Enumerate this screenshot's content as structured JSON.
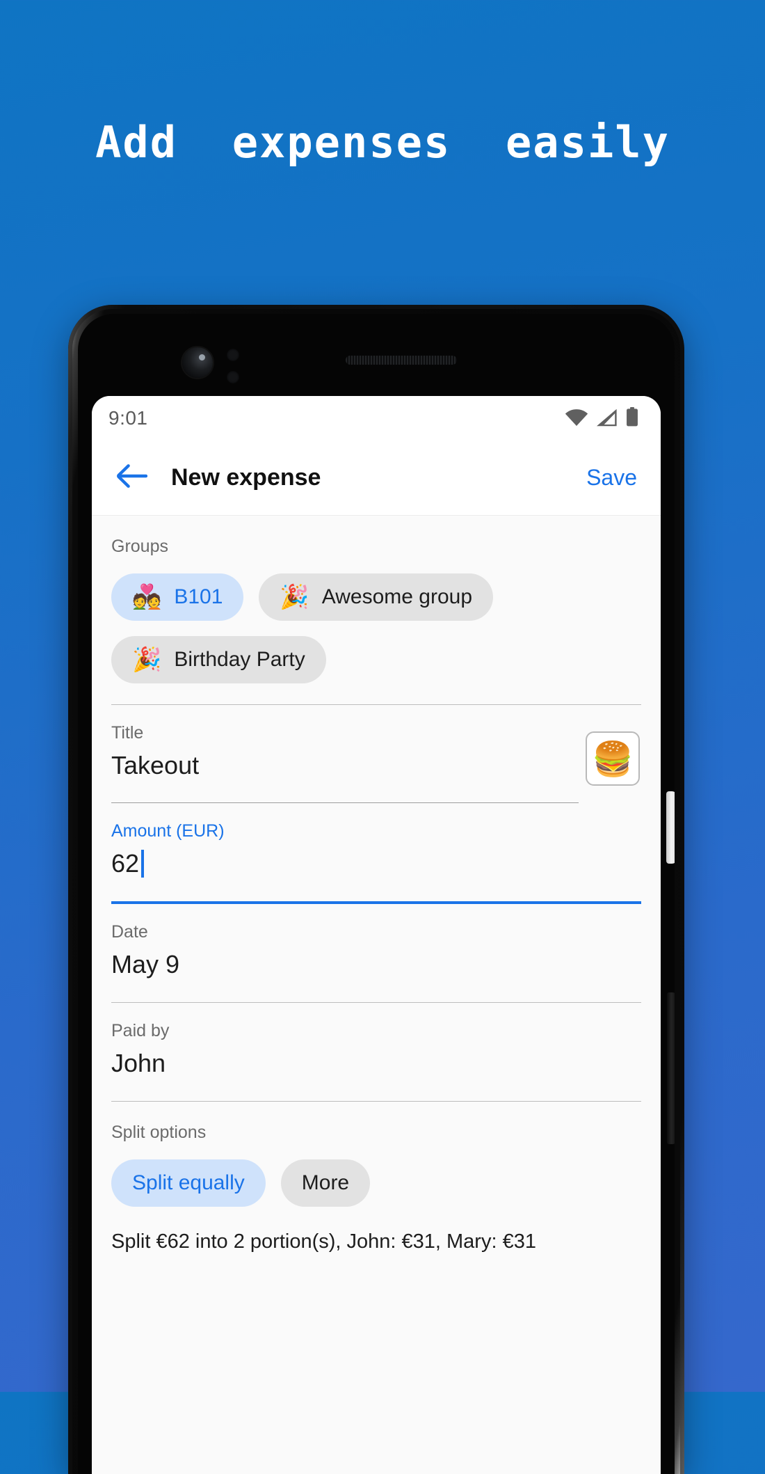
{
  "promo": {
    "headline": "Add  expenses  easily",
    "background_top": "#0f74c3",
    "background_bottom": "#3568cc"
  },
  "status_bar": {
    "time": "9:01",
    "icons": [
      "wifi-icon",
      "cell-signal-icon",
      "battery-icon"
    ]
  },
  "app_bar": {
    "back_icon": "back-arrow-icon",
    "title": "New expense",
    "save_label": "Save",
    "accent_color": "#1a73e8"
  },
  "groups": {
    "label": "Groups",
    "chips": [
      {
        "emoji": "💑",
        "label": "B101",
        "selected": true
      },
      {
        "emoji": "🎉",
        "label": "Awesome group",
        "selected": false
      },
      {
        "emoji": "🎉",
        "label": "Birthday Party",
        "selected": false
      }
    ]
  },
  "title_field": {
    "label": "Title",
    "value": "Takeout",
    "emoji": "🍔"
  },
  "amount_field": {
    "label": "Amount (EUR)",
    "value": "62",
    "focused": true
  },
  "date_field": {
    "label": "Date",
    "value": "May 9"
  },
  "paid_by_field": {
    "label": "Paid by",
    "value": "John"
  },
  "split": {
    "label": "Split options",
    "chips": [
      {
        "label": "Split equally",
        "selected": true
      },
      {
        "label": "More",
        "selected": false
      }
    ],
    "summary": "Split €62 into 2 portion(s), John: €31, Mary: €31"
  }
}
